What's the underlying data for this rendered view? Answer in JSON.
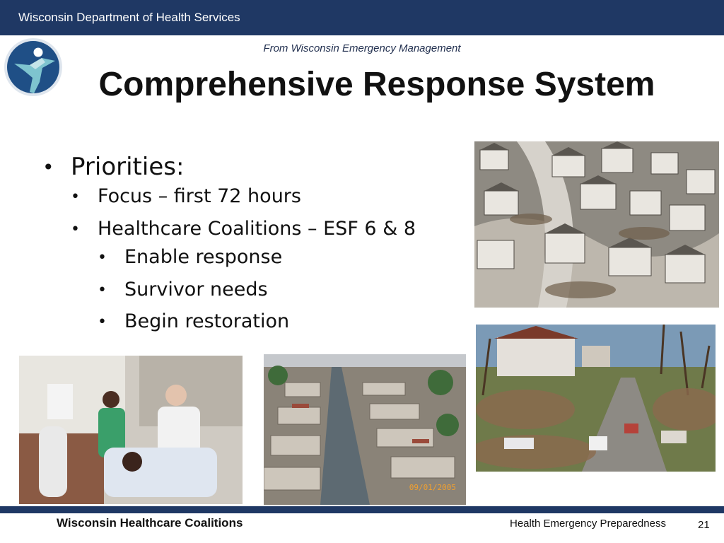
{
  "header": {
    "organization": "Wisconsin Department of Health Services",
    "bar_color": "#1f3864"
  },
  "logo": {
    "icon": "dhs-person-logo-icon"
  },
  "slide": {
    "source_note": "From Wisconsin Emergency Management",
    "title": "Comprehensive Response System",
    "bullets": {
      "level1": "Priorities:",
      "level2": [
        "Focus – first 72 hours",
        "Healthcare Coalitions – ESF 6 & 8"
      ],
      "level3": [
        "Enable response",
        "Survivor needs",
        "Begin restoration"
      ]
    }
  },
  "photos": {
    "flooded_street_date_stamp": "09/01/2005"
  },
  "footer": {
    "left_label": "Wisconsin Healthcare Coalitions",
    "right_label": "Health Emergency Preparedness",
    "page_number": "21"
  }
}
